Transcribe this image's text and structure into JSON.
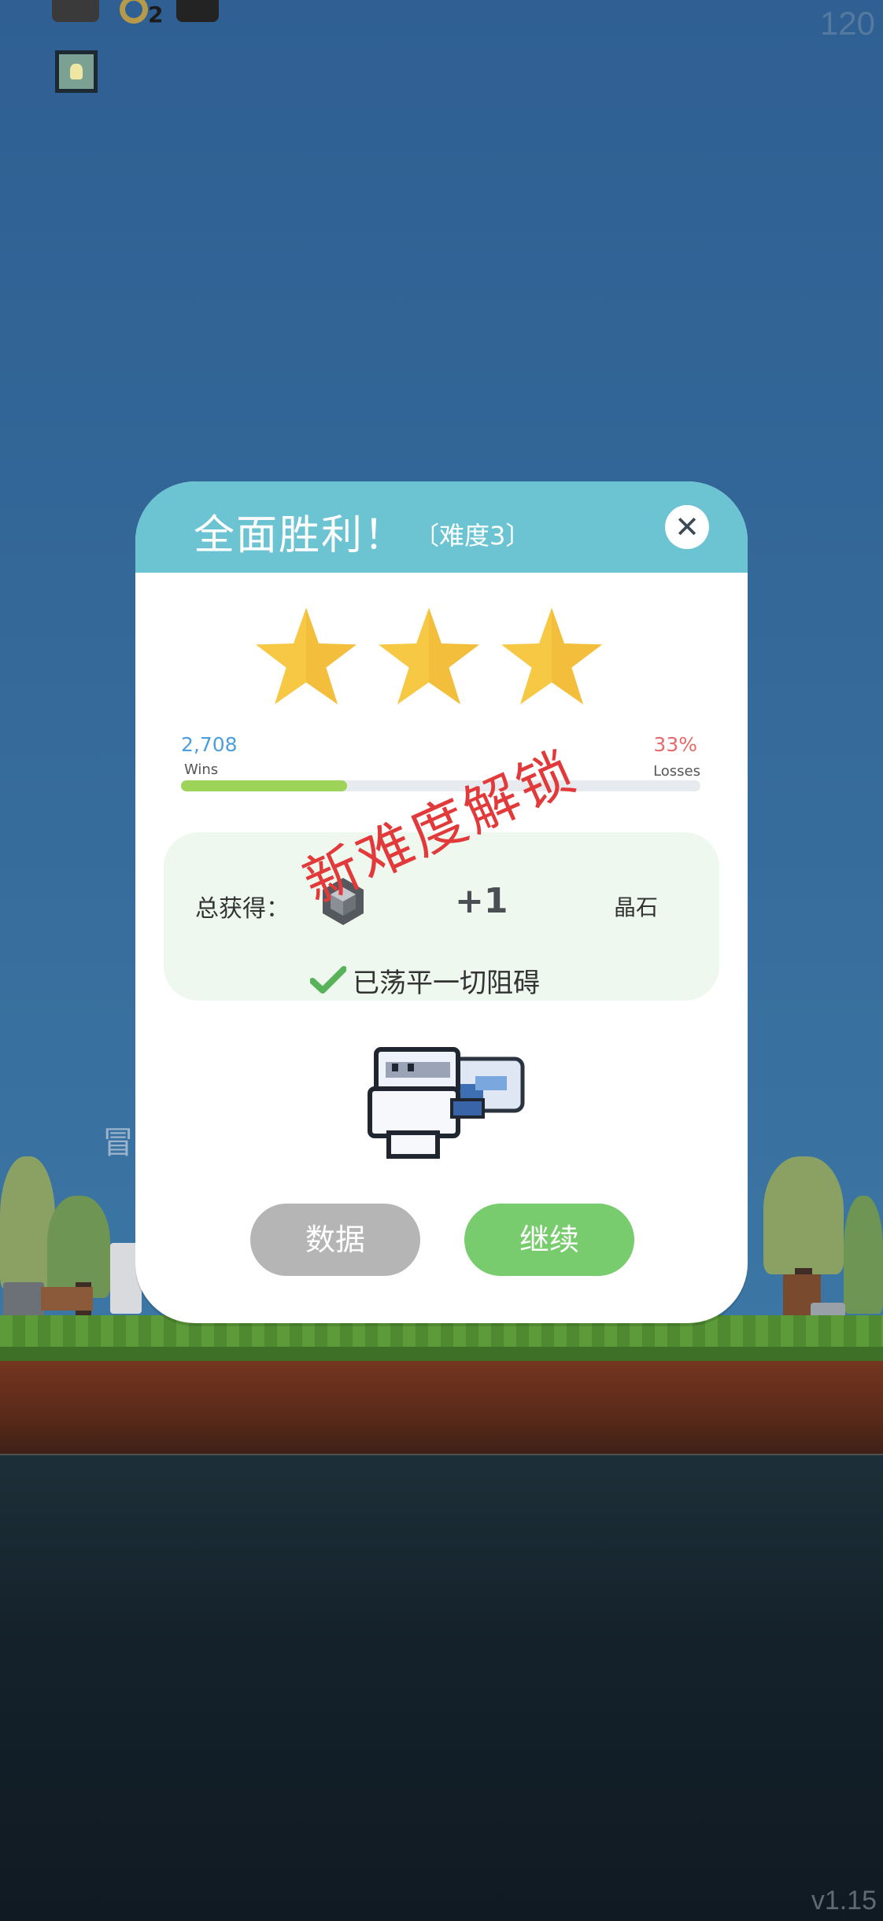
{
  "hud": {
    "fps": "120",
    "ring_count": "2",
    "version": "v1.15"
  },
  "background": {
    "partial_text": "冒"
  },
  "dialog": {
    "title": "全面胜利！",
    "difficulty": "〔难度3〕",
    "close_icon": "close-icon",
    "stars_earned": 3,
    "stars_total": 3,
    "wins_value": "2,708",
    "wins_label": "Wins",
    "losses_value": "33%",
    "losses_label": "Losses",
    "win_ratio": 0.32,
    "stamp_text": "新难度解锁",
    "reward": {
      "label": "总获得：",
      "amount": "+1",
      "unit": "晶石"
    },
    "cleared_text": "已荡平一切阻碍",
    "buttons": {
      "data": "数据",
      "continue": "继续"
    }
  },
  "colors": {
    "header": "#6cc4d3",
    "star": "#f6c844",
    "progress": "#9ed35a",
    "wins": "#4a9fdc",
    "losses": "#e56a6a",
    "stamp": "#e23a3a",
    "continue_button": "#78cc6d",
    "data_button": "#b5b5b5"
  }
}
